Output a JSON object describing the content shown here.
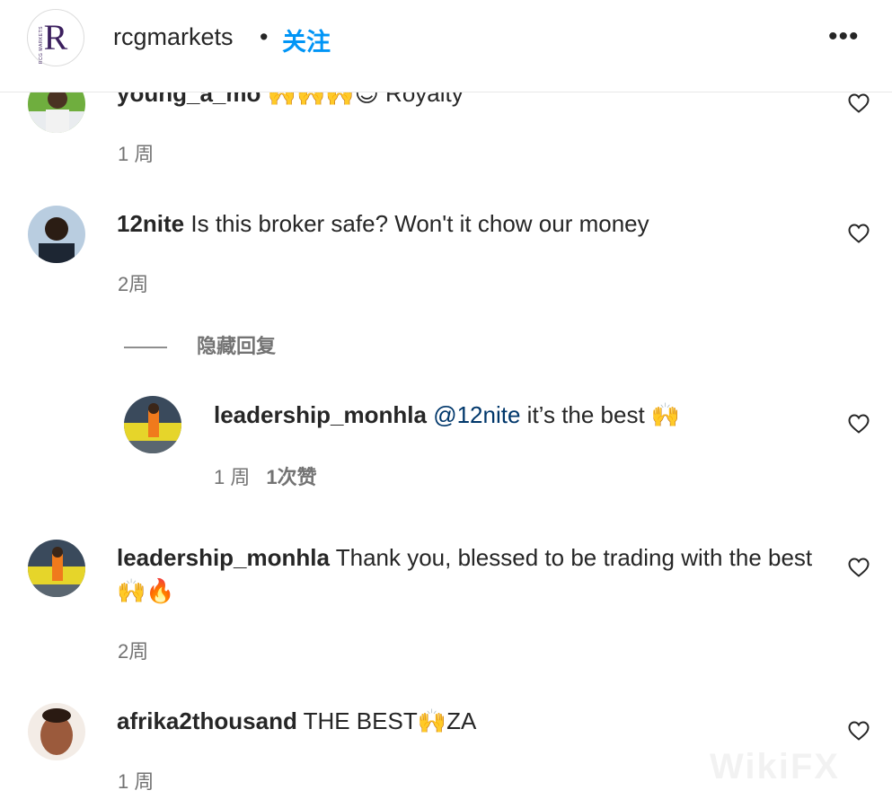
{
  "header": {
    "account_name": "rcgmarkets",
    "separator": "•",
    "follow_label": "关注",
    "more_icon": "more-horizontal-icon",
    "logo_letter": "R",
    "logo_side_text": "RCG MARKETS"
  },
  "comments": [
    {
      "username": "young_a_mo",
      "text": " 🙌🙌🙌😊 Royalty",
      "time": "1 周"
    },
    {
      "username": "12nite",
      "text": " Is this broker safe? Won't it chow our money",
      "time": "2周"
    },
    {
      "username": "leadership_monhla",
      "text": " Thank you, blessed to be trading with the best 🙌🔥",
      "time": "2周"
    },
    {
      "username": "afrika2thousand",
      "text": " THE BEST🙌ZA",
      "time": "1 周"
    }
  ],
  "replies_toggle": {
    "label": "隐藏回复"
  },
  "reply": {
    "username": "leadership_monhla",
    "mention": "@12nite",
    "text": " it’s the best 🙌",
    "time": "1 周",
    "likes": "1次赞"
  },
  "watermark": "WikiFX",
  "colors": {
    "accent": "#0095f6",
    "mention": "#00376b",
    "secondary_text": "#737373",
    "primary_text": "#262626"
  }
}
